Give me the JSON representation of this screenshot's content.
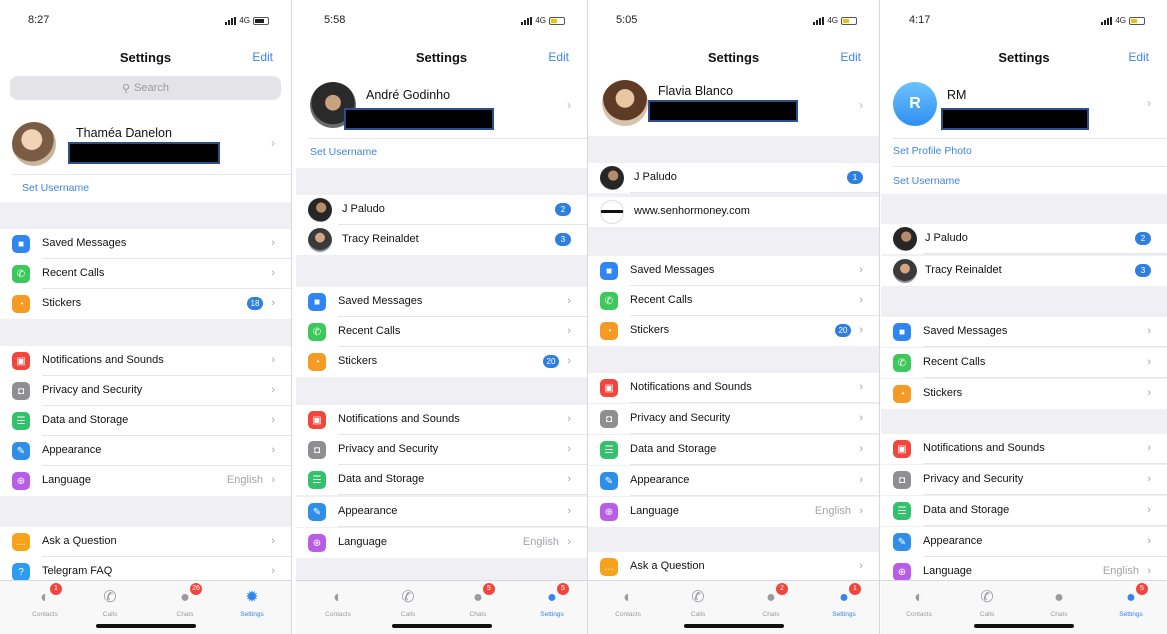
{
  "screens": [
    {
      "status": {
        "time": "8:27",
        "network": "4G"
      },
      "nav": {
        "title": "Settings",
        "edit": "Edit"
      },
      "search": {
        "placeholder": "Search"
      },
      "profile": {
        "name": "Thaméa Danelon",
        "avatar_type": "photo"
      },
      "links": [
        "Set Username"
      ],
      "groups": [
        [
          {
            "icon": "bookmark-icon",
            "color": "#2f86f0",
            "label": "Saved Messages"
          },
          {
            "icon": "phone-icon",
            "color": "#3cc85a",
            "label": "Recent Calls"
          },
          {
            "icon": "sticker-icon",
            "color": "#f59a23",
            "label": "Stickers",
            "badge": "18"
          }
        ],
        [
          {
            "icon": "bell-icon",
            "color": "#f2453c",
            "label": "Notifications and Sounds"
          },
          {
            "icon": "lock-icon",
            "color": "#8e8e93",
            "label": "Privacy and Security"
          },
          {
            "icon": "database-icon",
            "color": "#33c26b",
            "label": "Data and Storage"
          },
          {
            "icon": "brush-icon",
            "color": "#2f8fe8",
            "label": "Appearance"
          },
          {
            "icon": "globe-icon",
            "color": "#b85de6",
            "label": "Language",
            "value": "English"
          }
        ],
        [
          {
            "icon": "chat-question-icon",
            "color": "#f7a21b",
            "label": "Ask a Question"
          },
          {
            "icon": "question-icon",
            "color": "#2d9cf0",
            "label": "Telegram FAQ"
          }
        ]
      ],
      "tabs": {
        "contacts": "Contacts",
        "calls": "Calls",
        "chats": "Chats",
        "settings": "Settings",
        "contacts_badge": "1",
        "chats_badge": "26"
      }
    },
    {
      "status": {
        "time": "5:58",
        "network": "4G"
      },
      "nav": {
        "title": "Settings",
        "edit": "Edit"
      },
      "profile": {
        "name": "André Godinho",
        "avatar_type": "photo"
      },
      "links": [
        "Set Username"
      ],
      "accounts": [
        {
          "name": "J Paludo",
          "badge": "2"
        },
        {
          "name": "Tracy Reinaldet",
          "badge": "3"
        }
      ],
      "groups": [
        [
          {
            "icon": "bookmark-icon",
            "color": "#2f86f0",
            "label": "Saved Messages"
          },
          {
            "icon": "phone-icon",
            "color": "#3cc85a",
            "label": "Recent Calls"
          },
          {
            "icon": "sticker-icon",
            "color": "#f59a23",
            "label": "Stickers",
            "badge": "20"
          }
        ],
        [
          {
            "icon": "bell-icon",
            "color": "#f2453c",
            "label": "Notifications and Sounds"
          },
          {
            "icon": "lock-icon",
            "color": "#8e8e93",
            "label": "Privacy and Security"
          },
          {
            "icon": "database-icon",
            "color": "#33c26b",
            "label": "Data and Storage"
          },
          {
            "icon": "brush-icon",
            "color": "#2f8fe8",
            "label": "Appearance"
          },
          {
            "icon": "globe-icon",
            "color": "#b85de6",
            "label": "Language",
            "value": "English"
          }
        ]
      ],
      "tabs": {
        "contacts": "Contacts",
        "calls": "Calls",
        "chats": "Chats",
        "settings": "Settings",
        "chats_badge": "5",
        "settings_badge": "5"
      }
    },
    {
      "status": {
        "time": "5:05",
        "network": "4G"
      },
      "nav": {
        "title": "Settings",
        "edit": "Edit"
      },
      "profile": {
        "name": "Flavia Blanco",
        "avatar_type": "photo"
      },
      "accounts": [
        {
          "name": "J Paludo",
          "badge": "1"
        },
        {
          "name": "www.senhormoney.com"
        }
      ],
      "groups": [
        [
          {
            "icon": "bookmark-icon",
            "color": "#2f86f0",
            "label": "Saved Messages"
          },
          {
            "icon": "phone-icon",
            "color": "#3cc85a",
            "label": "Recent Calls"
          },
          {
            "icon": "sticker-icon",
            "color": "#f59a23",
            "label": "Stickers",
            "badge": "20"
          }
        ],
        [
          {
            "icon": "bell-icon",
            "color": "#f2453c",
            "label": "Notifications and Sounds"
          },
          {
            "icon": "lock-icon",
            "color": "#8e8e93",
            "label": "Privacy and Security"
          },
          {
            "icon": "database-icon",
            "color": "#33c26b",
            "label": "Data and Storage"
          },
          {
            "icon": "brush-icon",
            "color": "#2f8fe8",
            "label": "Appearance"
          },
          {
            "icon": "globe-icon",
            "color": "#b85de6",
            "label": "Language",
            "value": "English"
          }
        ],
        [
          {
            "icon": "chat-question-icon",
            "color": "#f7a21b",
            "label": "Ask a Question"
          }
        ]
      ],
      "tabs": {
        "contacts": "Contacts",
        "calls": "Calls",
        "chats": "Chats",
        "settings": "Settings",
        "chats_badge": "2",
        "settings_badge": "1"
      }
    },
    {
      "status": {
        "time": "4:17",
        "network": "4G"
      },
      "nav": {
        "title": "Settings",
        "edit": "Edit"
      },
      "profile": {
        "name": "RM",
        "avatar_type": "letter",
        "initial": "R"
      },
      "links": [
        "Set Profile Photo",
        "Set Username"
      ],
      "accounts": [
        {
          "name": "J Paludo",
          "badge": "2"
        },
        {
          "name": "Tracy Reinaldet",
          "badge": "3"
        }
      ],
      "groups": [
        [
          {
            "icon": "bookmark-icon",
            "color": "#2f86f0",
            "label": "Saved Messages"
          },
          {
            "icon": "phone-icon",
            "color": "#3cc85a",
            "label": "Recent Calls"
          },
          {
            "icon": "sticker-icon",
            "color": "#f59a23",
            "label": "Stickers"
          }
        ],
        [
          {
            "icon": "bell-icon",
            "color": "#f2453c",
            "label": "Notifications and Sounds"
          },
          {
            "icon": "lock-icon",
            "color": "#8e8e93",
            "label": "Privacy and Security"
          },
          {
            "icon": "database-icon",
            "color": "#33c26b",
            "label": "Data and Storage"
          },
          {
            "icon": "brush-icon",
            "color": "#2f8fe8",
            "label": "Appearance"
          },
          {
            "icon": "globe-icon",
            "color": "#b85de6",
            "label": "Language",
            "value": "English"
          }
        ]
      ],
      "tabs": {
        "contacts": "Contacts",
        "calls": "Calls",
        "chats": "Chats",
        "settings": "Settings",
        "settings_badge": "5"
      }
    }
  ]
}
